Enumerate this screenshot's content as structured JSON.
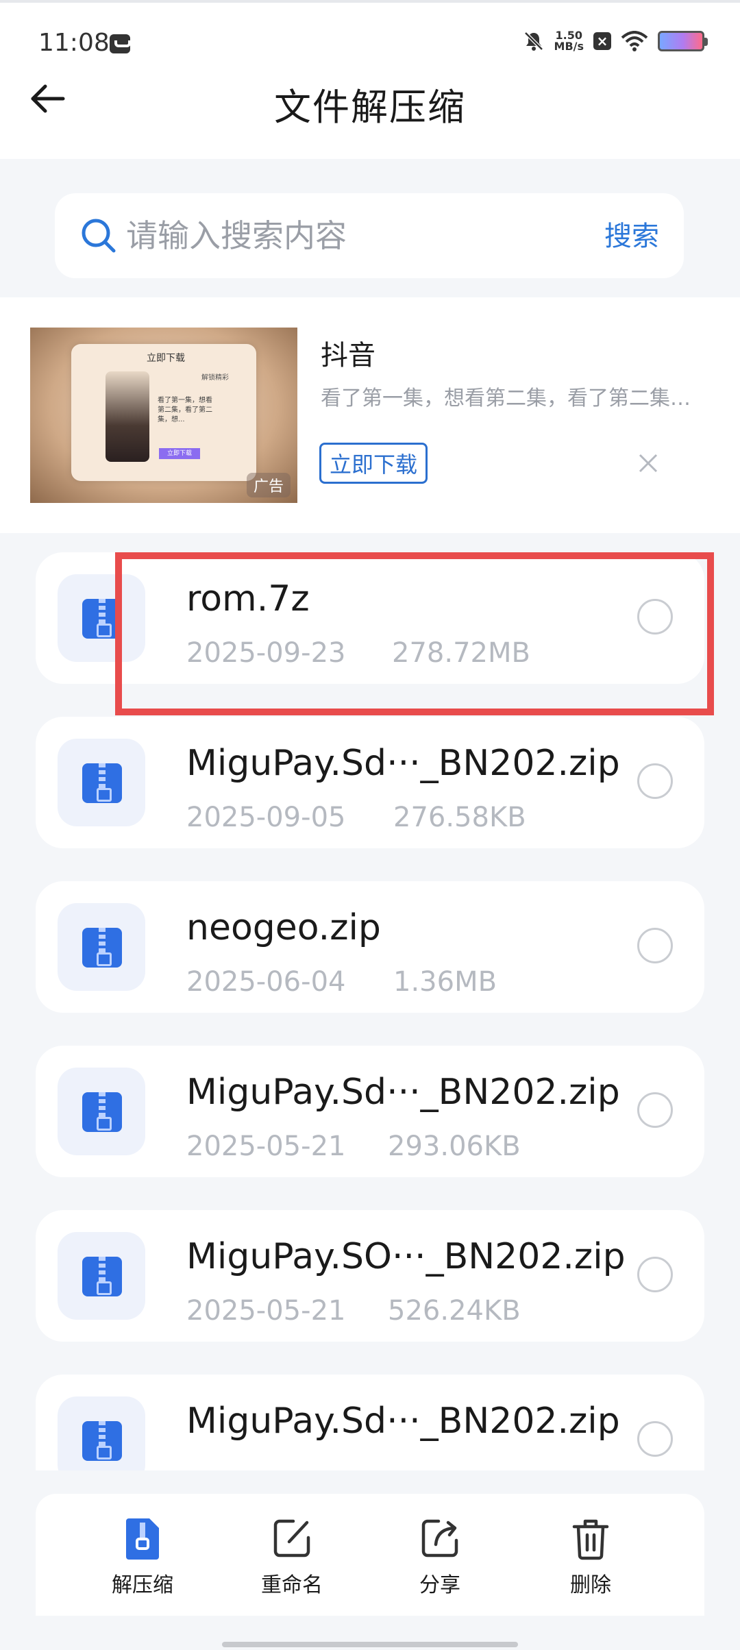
{
  "status_bar": {
    "time": "11:08",
    "speed_value": "1.50",
    "speed_unit": "MB/s"
  },
  "header": {
    "title": "文件解压缩"
  },
  "search": {
    "placeholder": "请输入搜索内容",
    "button_label": "搜索"
  },
  "ad": {
    "app_name": "抖音",
    "description": "看了第一集，想看第二集，看了第二集，想看第三集",
    "download_label": "立即下载",
    "badge": "广告",
    "image_title": "立即下载",
    "image_sub": "解锁精彩",
    "image_text": "看了第一集，想看第二集，看了第二集，想...",
    "image_button": "立即下载"
  },
  "files": [
    {
      "name": "rom.7z",
      "date": "2025-09-23",
      "size": "278.72MB"
    },
    {
      "name": "MiguPay.Sd···_BN202.zip",
      "date": "2025-09-05",
      "size": "276.58KB"
    },
    {
      "name": "neogeo.zip",
      "date": "2025-06-04",
      "size": "1.36MB"
    },
    {
      "name": "MiguPay.Sd···_BN202.zip",
      "date": "2025-05-21",
      "size": "293.06KB"
    },
    {
      "name": "MiguPay.SO···_BN202.zip",
      "date": "2025-05-21",
      "size": "526.24KB"
    },
    {
      "name": "MiguPay.Sd···_BN202.zip",
      "date": "",
      "size": ""
    }
  ],
  "actions": {
    "extract": "解压缩",
    "rename": "重命名",
    "share": "分享",
    "delete": "删除"
  },
  "colors": {
    "accent": "#2b77d9",
    "highlight": "#e84c4c",
    "zip_icon": "#2f6fe3"
  }
}
